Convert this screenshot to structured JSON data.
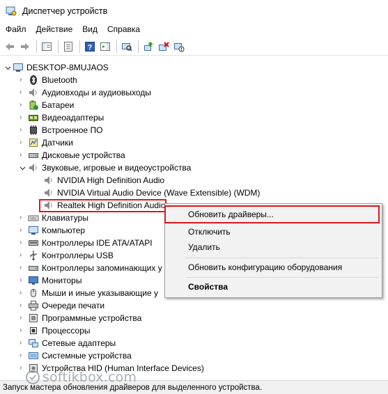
{
  "window": {
    "title": "Диспетчер устройств"
  },
  "menu": [
    "Файл",
    "Действие",
    "Вид",
    "Справка"
  ],
  "tree": {
    "root": "DESKTOP-8MUJAOS",
    "categories": [
      {
        "label": "Bluetooth",
        "icon": "bluetooth-icon"
      },
      {
        "label": "Аудиовходы и аудиовыходы",
        "icon": "speaker-icon"
      },
      {
        "label": "Батареи",
        "icon": "battery-icon"
      },
      {
        "label": "Видеоадаптеры",
        "icon": "display-adapter-icon"
      },
      {
        "label": "Встроенное ПО",
        "icon": "firmware-icon"
      },
      {
        "label": "Датчики",
        "icon": "sensor-icon"
      },
      {
        "label": "Дисковые устройства",
        "icon": "disk-icon"
      },
      {
        "label": "Звуковые, игровые и видеоустройства",
        "icon": "speaker-icon"
      }
    ],
    "sound_children": [
      "NVIDIA High Definition Audio",
      "NVIDIA Virtual Audio Device (Wave Extensible) (WDM)",
      "Realtek High Definition Audio"
    ],
    "categories_after": [
      {
        "label": "Клавиатуры",
        "icon": "keyboard-icon"
      },
      {
        "label": "Компьютер",
        "icon": "computer-icon"
      },
      {
        "label": "Контроллеры IDE ATA/ATAPI",
        "icon": "ide-icon"
      },
      {
        "label": "Контроллеры USB",
        "icon": "usb-icon"
      },
      {
        "label": "Контроллеры запоминающих у",
        "icon": "storage-icon"
      },
      {
        "label": "Мониторы",
        "icon": "monitor-icon"
      },
      {
        "label": "Мыши и иные указывающие у",
        "icon": "mouse-icon"
      },
      {
        "label": "Очереди печати",
        "icon": "printer-icon"
      },
      {
        "label": "Программные устройства",
        "icon": "software-device-icon"
      },
      {
        "label": "Процессоры",
        "icon": "cpu-icon"
      },
      {
        "label": "Сетевые адаптеры",
        "icon": "network-icon"
      },
      {
        "label": "Системные устройства",
        "icon": "system-icon"
      },
      {
        "label": "Устройства HID (Human Interface Devices)",
        "icon": "hid-icon"
      }
    ]
  },
  "context_menu": {
    "update": "Обновить драйверы...",
    "disable": "Отключить",
    "uninstall": "Удалить",
    "scan": "Обновить конфигурацию оборудования",
    "properties": "Свойства"
  },
  "statusbar": {
    "text": "Запуск мастера обновления драйверов для выделенного устройства."
  },
  "watermark": {
    "text": "softikbox.com"
  },
  "colors": {
    "highlight": "#e0151b",
    "accent": "#1e5fb4"
  }
}
